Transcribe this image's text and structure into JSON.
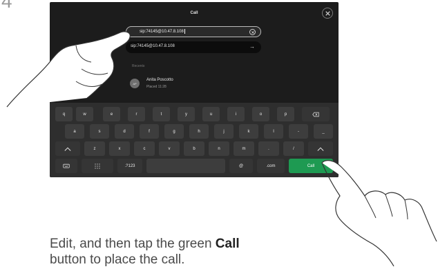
{
  "step_number": "4",
  "screen": {
    "title": "Call",
    "search_value": "sip:74145@10.47.8.108",
    "suggestion_value": "sip:74145@10.47.8.108",
    "recents_label": "Recents",
    "contact": {
      "initials": "AP",
      "name": "Anita Poscotto",
      "detail": "Placed 11:28"
    }
  },
  "keyboard": {
    "row1": [
      "q",
      "w",
      "e",
      "r",
      "t",
      "y",
      "u",
      "i",
      "o",
      "p"
    ],
    "row2": [
      "a",
      "s",
      "d",
      "f",
      "g",
      "h",
      "j",
      "k",
      "l",
      "-",
      "_"
    ],
    "row3": [
      "z",
      "x",
      "c",
      "v",
      "b",
      "n",
      "m",
      ".",
      "/"
    ],
    "row4": {
      "numbers": ".?123",
      "at": "@",
      "dotcom": ".com",
      "call": "Call"
    },
    "icons": [
      "backspace-icon",
      "shift-icon",
      "keyboard-icon",
      "grid-icon"
    ]
  },
  "instructions": {
    "before": "Edit, and then tap the green ",
    "bold": "Call",
    "after": "button to place the call."
  },
  "colors": {
    "screen_bg": "#1c1c1c",
    "keyboard_bg": "#2e2e2e",
    "call_green": "#1e9a52"
  }
}
